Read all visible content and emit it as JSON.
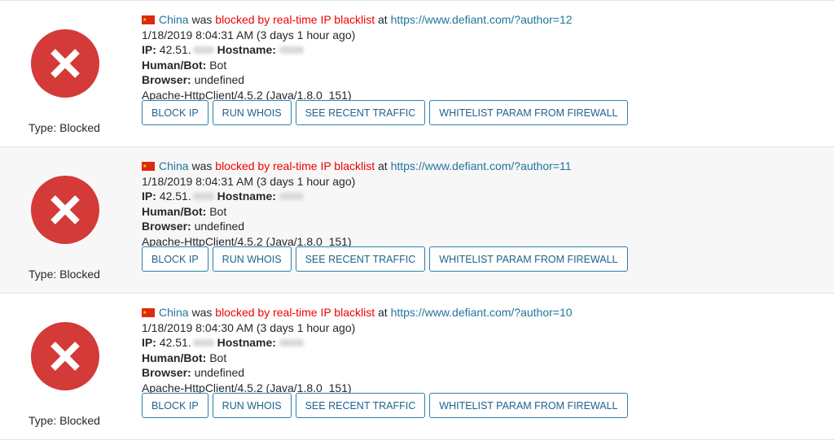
{
  "colors": {
    "link": "#21759b",
    "danger": "#f00000",
    "icon_bg": "#d33a38",
    "button_border": "#2e7fae"
  },
  "entries": [
    {
      "status_icon": "blocked-x-icon",
      "type_label": "Type: Blocked",
      "flag_icon": "china-flag-icon",
      "country": "China",
      "was": "was",
      "reason": "blocked by real-time IP blacklist",
      "at": "at",
      "url": "https://www.defiant.com/?author=12",
      "timestamp": "1/18/2019 8:04:31 AM (3 days 1 hour ago)",
      "ip_label": "IP:",
      "ip_value": "42.51.",
      "hostname_label": "Hostname:",
      "human_bot_label": "Human/Bot:",
      "human_bot_value": "Bot",
      "browser_label": "Browser:",
      "browser_value": "undefined",
      "user_agent": "Apache-HttpClient/4.5.2 (Java/1.8.0_151)",
      "buttons": [
        "BLOCK IP",
        "RUN WHOIS",
        "SEE RECENT TRAFFIC",
        "WHITELIST PARAM FROM FIREWALL"
      ]
    },
    {
      "status_icon": "blocked-x-icon",
      "type_label": "Type: Blocked",
      "flag_icon": "china-flag-icon",
      "country": "China",
      "was": "was",
      "reason": "blocked by real-time IP blacklist",
      "at": "at",
      "url": "https://www.defiant.com/?author=11",
      "timestamp": "1/18/2019 8:04:31 AM (3 days 1 hour ago)",
      "ip_label": "IP:",
      "ip_value": "42.51.",
      "hostname_label": "Hostname:",
      "human_bot_label": "Human/Bot:",
      "human_bot_value": "Bot",
      "browser_label": "Browser:",
      "browser_value": "undefined",
      "user_agent": "Apache-HttpClient/4.5.2 (Java/1.8.0_151)",
      "buttons": [
        "BLOCK IP",
        "RUN WHOIS",
        "SEE RECENT TRAFFIC",
        "WHITELIST PARAM FROM FIREWALL"
      ]
    },
    {
      "status_icon": "blocked-x-icon",
      "type_label": "Type: Blocked",
      "flag_icon": "china-flag-icon",
      "country": "China",
      "was": "was",
      "reason": "blocked by real-time IP blacklist",
      "at": "at",
      "url": "https://www.defiant.com/?author=10",
      "timestamp": "1/18/2019 8:04:30 AM (3 days 1 hour ago)",
      "ip_label": "IP:",
      "ip_value": "42.51.",
      "hostname_label": "Hostname:",
      "human_bot_label": "Human/Bot:",
      "human_bot_value": "Bot",
      "browser_label": "Browser:",
      "browser_value": "undefined",
      "user_agent": "Apache-HttpClient/4.5.2 (Java/1.8.0_151)",
      "buttons": [
        "BLOCK IP",
        "RUN WHOIS",
        "SEE RECENT TRAFFIC",
        "WHITELIST PARAM FROM FIREWALL"
      ]
    }
  ]
}
